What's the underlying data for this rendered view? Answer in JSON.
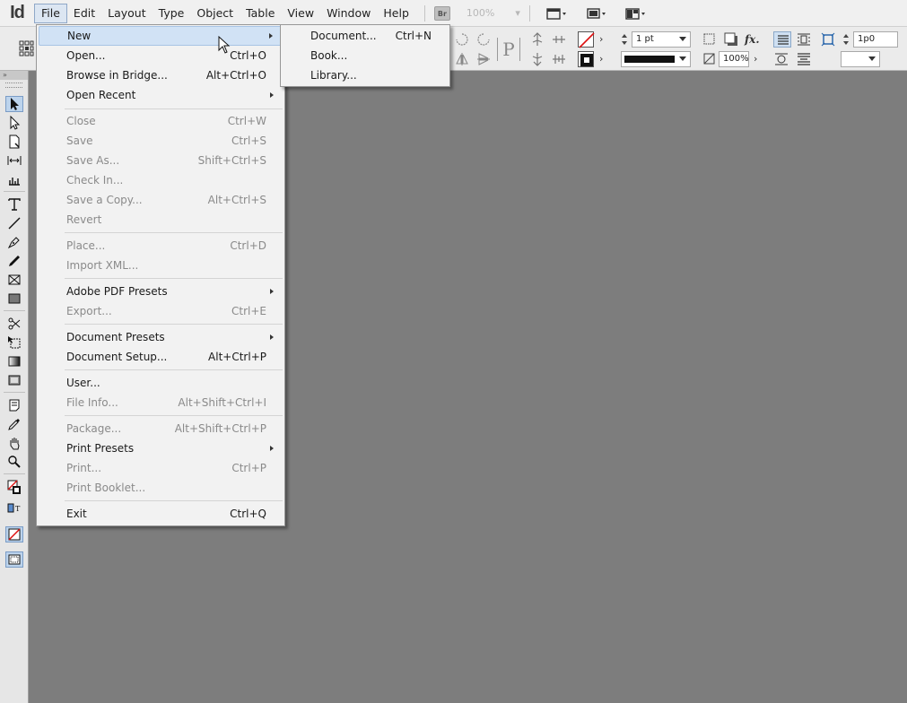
{
  "app": {
    "logo": "Id"
  },
  "menubar": {
    "items": [
      "File",
      "Edit",
      "Layout",
      "Type",
      "Object",
      "Table",
      "View",
      "Window",
      "Help"
    ],
    "bridge_label": "Br",
    "zoom": "100%"
  },
  "control_panel": {
    "stroke_weight": "1 pt",
    "scale_percent": "100%",
    "offset_value": "1p0",
    "para_glyph": "P"
  },
  "file_menu": {
    "items": [
      {
        "label": "New",
        "shortcut": "",
        "submenu": true,
        "enabled": true
      },
      {
        "label": "Open...",
        "shortcut": "Ctrl+O",
        "enabled": true
      },
      {
        "label": "Browse in Bridge...",
        "shortcut": "Alt+Ctrl+O",
        "enabled": true
      },
      {
        "label": "Open Recent",
        "shortcut": "",
        "submenu": true,
        "enabled": true
      },
      {
        "label": "Close",
        "shortcut": "Ctrl+W",
        "enabled": false
      },
      {
        "label": "Save",
        "shortcut": "Ctrl+S",
        "enabled": false
      },
      {
        "label": "Save As...",
        "shortcut": "Shift+Ctrl+S",
        "enabled": false
      },
      {
        "label": "Check In...",
        "shortcut": "",
        "enabled": false
      },
      {
        "label": "Save a Copy...",
        "shortcut": "Alt+Ctrl+S",
        "enabled": false
      },
      {
        "label": "Revert",
        "shortcut": "",
        "enabled": false
      },
      {
        "label": "Place...",
        "shortcut": "Ctrl+D",
        "enabled": false
      },
      {
        "label": "Import XML...",
        "shortcut": "",
        "enabled": false
      },
      {
        "label": "Adobe PDF Presets",
        "shortcut": "",
        "submenu": true,
        "enabled": true
      },
      {
        "label": "Export...",
        "shortcut": "Ctrl+E",
        "enabled": false
      },
      {
        "label": "Document Presets",
        "shortcut": "",
        "submenu": true,
        "enabled": true
      },
      {
        "label": "Document Setup...",
        "shortcut": "Alt+Ctrl+P",
        "enabled": true
      },
      {
        "label": "User...",
        "shortcut": "",
        "enabled": true
      },
      {
        "label": "File Info...",
        "shortcut": "Alt+Shift+Ctrl+I",
        "enabled": false
      },
      {
        "label": "Package...",
        "shortcut": "Alt+Shift+Ctrl+P",
        "enabled": false
      },
      {
        "label": "Print Presets",
        "shortcut": "",
        "submenu": true,
        "enabled": true
      },
      {
        "label": "Print...",
        "shortcut": "Ctrl+P",
        "enabled": false
      },
      {
        "label": "Print Booklet...",
        "shortcut": "",
        "enabled": false
      },
      {
        "label": "Exit",
        "shortcut": "Ctrl+Q",
        "enabled": true
      }
    ]
  },
  "new_submenu": {
    "items": [
      {
        "label": "Document...",
        "shortcut": "Ctrl+N"
      },
      {
        "label": "Book...",
        "shortcut": ""
      },
      {
        "label": "Library...",
        "shortcut": ""
      }
    ]
  },
  "colors": {
    "canvas": "#7d7d7d",
    "highlight": "#d1e2f5",
    "menu_bg": "#f2f2f2"
  }
}
